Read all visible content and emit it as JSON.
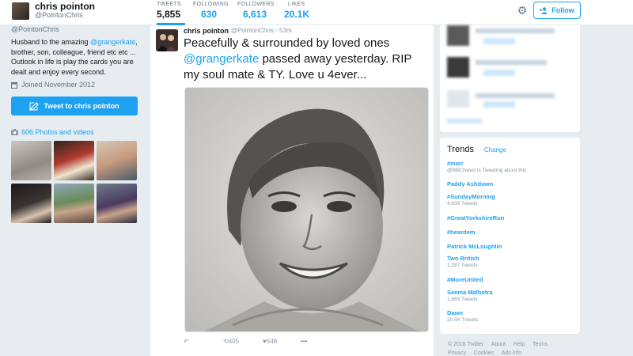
{
  "profile": {
    "name": "chris pointon",
    "handle": "@PointonChris",
    "bio_prefix": "Husband to the amazing ",
    "bio_mention": "@grangerkate",
    "bio_rest": ", brother, son, colleague, friend etc etc ... Outlook in life is play the cards you are dealt and enjoy every second.",
    "joined": "Joined November 2012",
    "tweet_to_label": "Tweet to chris pointon",
    "photos_label": "606 Photos and videos"
  },
  "stats": [
    {
      "label": "TWEETS",
      "value": "5,855"
    },
    {
      "label": "FOLLOWING",
      "value": "630"
    },
    {
      "label": "FOLLOWERS",
      "value": "6,613"
    },
    {
      "label": "LIKES",
      "value": "20.1K"
    }
  ],
  "follow_label": "Follow",
  "tweet": {
    "name": "chris pointon",
    "handle": "@PointonChris",
    "time": "· 53m",
    "text_1": "Peacefully & surrounded by loved ones ",
    "mention": "@grangerkate",
    "text_2": " passed away yesterday. RIP my soul mate & TY. Love u 4ever...",
    "retweets": "405",
    "likes": "546"
  },
  "trends": {
    "title": "Trends",
    "change": "· Change",
    "items": [
      {
        "name": "#marr",
        "sub": "@BBCNews is Tweeting about this"
      },
      {
        "name": "Paddy Ashdown",
        "sub": ""
      },
      {
        "name": "#SundayMorning",
        "sub": "4,639 Tweets"
      },
      {
        "name": "#GreatYorkshireRun",
        "sub": ""
      },
      {
        "name": "#heardem",
        "sub": ""
      },
      {
        "name": "Patrick McLoughlin",
        "sub": ""
      },
      {
        "name": "Two British",
        "sub": "1,287 Tweets"
      },
      {
        "name": "#MoreUnited",
        "sub": ""
      },
      {
        "name": "Seema Malhotra",
        "sub": "1,869 Tweets"
      },
      {
        "name": "Dawn",
        "sub": "20.5K Tweets"
      }
    ]
  },
  "footer": {
    "copyright": "© 2016 Twitter",
    "about": "About",
    "help": "Help",
    "terms": "Terms",
    "privacy": "Privacy",
    "cookies": "Cookies",
    "ads": "Ads info"
  },
  "colors": {
    "accent": "#1da1f2",
    "background": "#e6ecf0"
  }
}
